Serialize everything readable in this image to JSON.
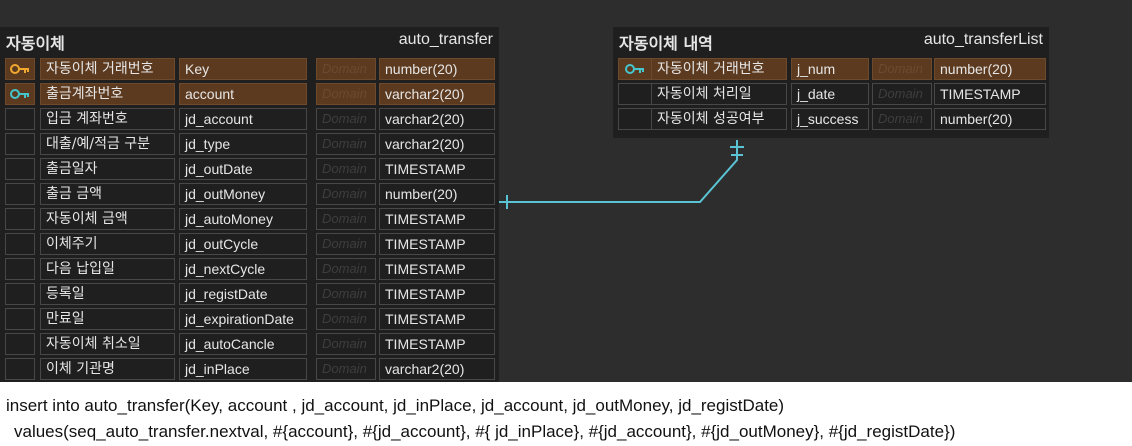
{
  "colors": {
    "canvas": "#2d2d2d",
    "table_body": "#1f1f1f",
    "pk_row": "#5c3a1f",
    "key_icon": "#f0a830",
    "fk_key_icon": "#45c4cc",
    "relation_line": "#5bc4d4"
  },
  "tables": [
    {
      "logical_name": "자동이체",
      "physical_name": "auto_transfer",
      "columns": [
        {
          "pk": true,
          "key_icon": "key-icon-orange",
          "logical": "자동이체 거래번호",
          "physical": "Key",
          "domain": "Domain",
          "type": "number(20)"
        },
        {
          "pk": true,
          "key_icon": "key-icon-teal",
          "logical": "출금계좌번호",
          "physical": "account",
          "domain": "Domain",
          "type": "varchar2(20)"
        },
        {
          "pk": false,
          "logical": "입금 계좌번호",
          "physical": "jd_account",
          "domain": "Domain",
          "type": "varchar2(20)"
        },
        {
          "pk": false,
          "logical": "대출/예/적금 구분",
          "physical": "jd_type",
          "domain": "Domain",
          "type": "varchar2(20)"
        },
        {
          "pk": false,
          "logical": "출금일자",
          "physical": "jd_outDate",
          "domain": "Domain",
          "type": "TIMESTAMP"
        },
        {
          "pk": false,
          "logical": "출금 금액",
          "physical": "jd_outMoney",
          "domain": "Domain",
          "type": "number(20)"
        },
        {
          "pk": false,
          "logical": "자동이체 금액",
          "physical": "jd_autoMoney",
          "domain": "Domain",
          "type": "TIMESTAMP"
        },
        {
          "pk": false,
          "logical": "이체주기",
          "physical": "jd_outCycle",
          "domain": "Domain",
          "type": "TIMESTAMP"
        },
        {
          "pk": false,
          "logical": "다음 납입일",
          "physical": "jd_nextCycle",
          "domain": "Domain",
          "type": "TIMESTAMP"
        },
        {
          "pk": false,
          "logical": "등록일",
          "physical": "jd_registDate",
          "domain": "Domain",
          "type": "TIMESTAMP"
        },
        {
          "pk": false,
          "logical": "만료일",
          "physical": "jd_expirationDate",
          "domain": "Domain",
          "type": "TIMESTAMP"
        },
        {
          "pk": false,
          "logical": "자동이체 취소일",
          "physical": "jd_autoCancle",
          "domain": "Domain",
          "type": "TIMESTAMP"
        },
        {
          "pk": false,
          "logical": "이체 기관명",
          "physical": "jd_inPlace",
          "domain": "Domain",
          "type": "varchar2(20)"
        }
      ]
    },
    {
      "logical_name": "자동이체 내역",
      "physical_name": "auto_transferList",
      "columns": [
        {
          "pk": true,
          "key_icon": "key-icon-teal",
          "logical": "자동이체 거래번호",
          "physical": "j_num",
          "domain": "Domain",
          "type": "number(20)"
        },
        {
          "pk": false,
          "logical": "자동이체 처리일",
          "physical": "j_date",
          "domain": "Domain",
          "type": "TIMESTAMP"
        },
        {
          "pk": false,
          "logical": "자동이체 성공여부",
          "physical": "j_success",
          "domain": "Domain",
          "type": "number(20)"
        }
      ]
    }
  ],
  "sql": {
    "line1": "insert into auto_transfer(Key, account   , jd_account, jd_inPlace, jd_account, jd_outMoney, jd_registDate)",
    "line2": "values(seq_auto_transfer.nextval, #{account}, #{jd_account}, #{ jd_inPlace}, #{jd_account}, #{jd_outMoney}, #{jd_registDate})"
  }
}
